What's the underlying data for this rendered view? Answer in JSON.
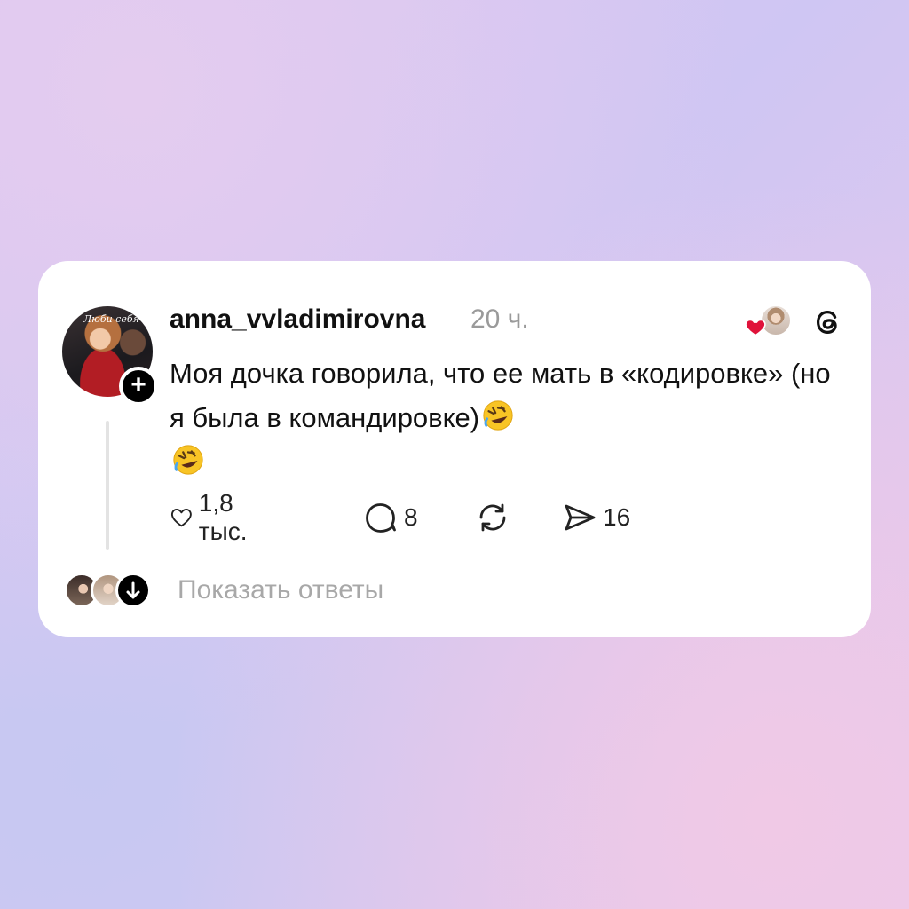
{
  "post": {
    "username": "anna_vvladimirovna",
    "timestamp": "20 ч.",
    "avatar_caption": "Люби себя",
    "text": "Моя дочка говорила, что ее мать в «кодировке» (но я была в командировке)",
    "text_emojis": [
      "rolling-on-floor-laughing-emoji",
      "rolling-on-floor-laughing-emoji"
    ]
  },
  "actions": {
    "likes": "1,8 тыс.",
    "comments": "8",
    "reposts": "",
    "shares": "16"
  },
  "replies": {
    "show_label": "Показать ответы"
  },
  "colors": {
    "heart": "#e0123a",
    "text": "#111111",
    "muted": "#9a9a9a"
  }
}
